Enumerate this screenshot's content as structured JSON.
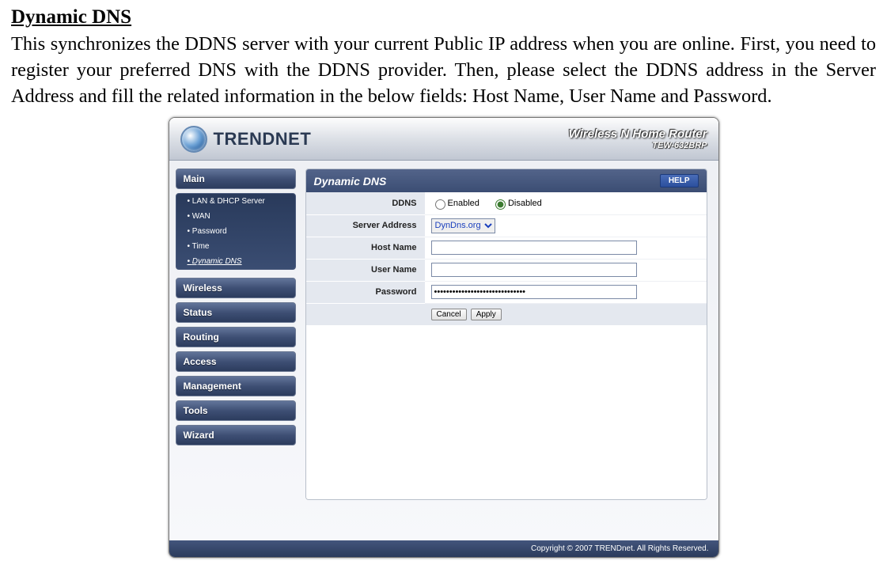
{
  "doc": {
    "title": "Dynamic DNS",
    "intro": "This synchronizes the DDNS server with your current Public IP address when you are online.  First, you need to register your preferred DNS with the DDNS provider.  Then, please select the DDNS address in the Server Address and fill the related information in the below fields: Host Name, User Name and Password."
  },
  "header": {
    "brand": "TRENDNET",
    "product": "Wireless N Home Router",
    "model": "TEW-632BRP"
  },
  "sidebar": {
    "main_label": "Main",
    "main_items": [
      "LAN & DHCP Server",
      "WAN",
      "Password",
      "Time",
      "Dynamic DNS"
    ],
    "active_item": "Dynamic DNS",
    "sections": [
      "Wireless",
      "Status",
      "Routing",
      "Access",
      "Management",
      "Tools",
      "Wizard"
    ]
  },
  "panel": {
    "title": "Dynamic DNS",
    "help_label": "HELP",
    "rows": {
      "ddns_label": "DDNS",
      "ddns_enabled": "Enabled",
      "ddns_disabled": "Disabled",
      "ddns_value": "Disabled",
      "server_address_label": "Server Address",
      "server_address_value": "DynDns.org",
      "host_name_label": "Host Name",
      "host_name_value": "",
      "user_name_label": "User Name",
      "user_name_value": "",
      "password_label": "Password",
      "password_value": "••••••••••••••••••••••••••••••"
    },
    "buttons": {
      "cancel": "Cancel",
      "apply": "Apply"
    }
  },
  "footer": {
    "text": "Copyright © 2007 TRENDnet. All Rights Reserved."
  }
}
